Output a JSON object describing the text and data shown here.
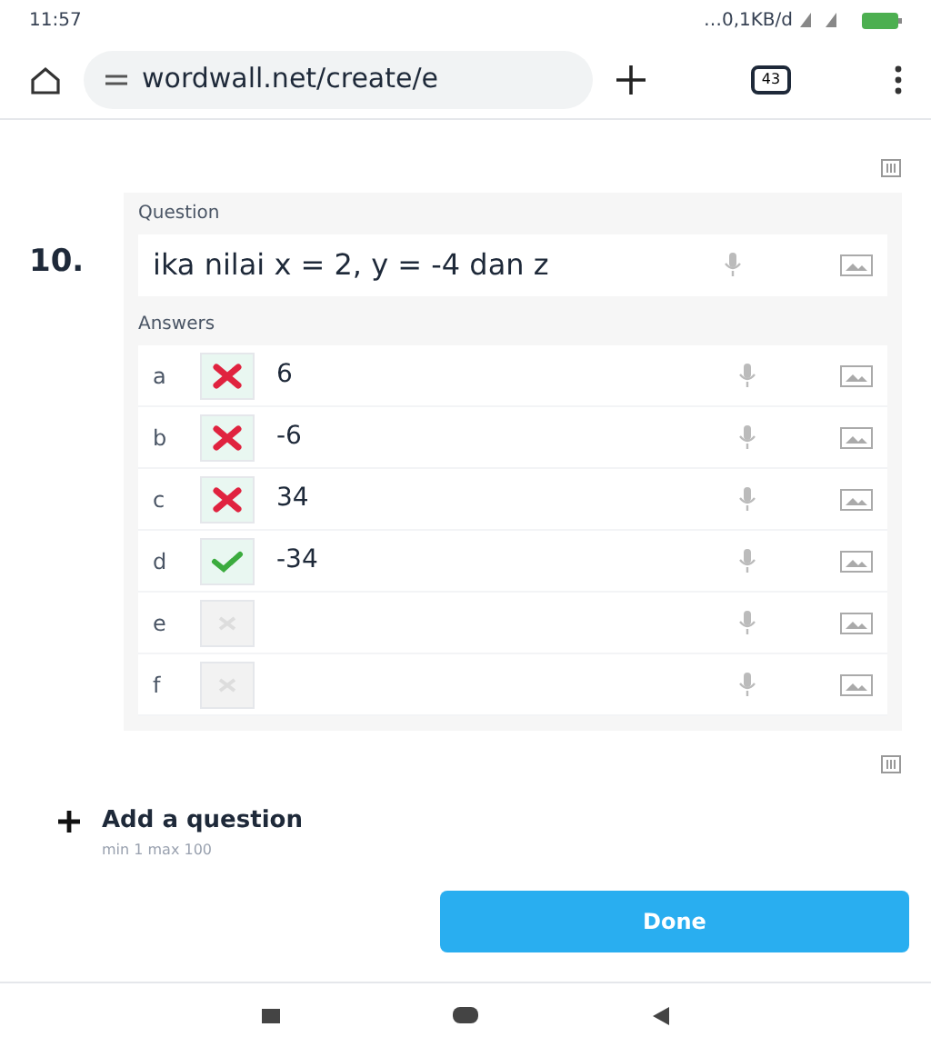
{
  "status_bar": {
    "time": "11:57",
    "data_rate": "…0,1KB/d"
  },
  "browser": {
    "url": "wordwall.net/create/e",
    "tab_count": "43"
  },
  "question": {
    "number": "10.",
    "label": "Question",
    "text": "ika nilai x = 2, y = -4 dan z"
  },
  "answers_label": "Answers",
  "answers": [
    {
      "letter": "a",
      "kind": "wrong",
      "text": "6"
    },
    {
      "letter": "b",
      "kind": "wrong",
      "text": "-6"
    },
    {
      "letter": "c",
      "kind": "wrong",
      "text": "34"
    },
    {
      "letter": "d",
      "kind": "right",
      "text": "-34"
    },
    {
      "letter": "e",
      "kind": "blank"
    },
    {
      "letter": "f",
      "kind": "blank"
    }
  ],
  "add_question": {
    "label": "Add a question",
    "hint": "min 1 max 100"
  },
  "done_button": "Done"
}
